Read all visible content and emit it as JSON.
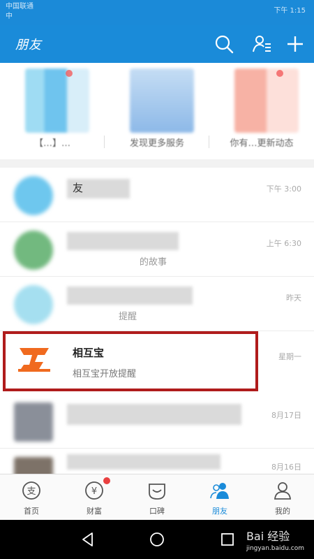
{
  "status_bar": {
    "carrier": "中国联通",
    "carrier2": "中",
    "time": "下午 1:15"
  },
  "header": {
    "title": "朋友",
    "icons": [
      "search-icon",
      "contacts-icon",
      "add-icon"
    ]
  },
  "services": [
    {
      "label": "【…】…",
      "has_dot": true
    },
    {
      "label": "发现更多服务",
      "has_dot": false
    },
    {
      "label": "你有…更新动态",
      "has_dot": true
    }
  ],
  "list": {
    "rows": [
      {
        "name": "友",
        "sub": "",
        "time": "下午 3:00"
      },
      {
        "name": "",
        "sub": "的故事",
        "time": "上午 6:30"
      },
      {
        "name": "",
        "sub": "提醒",
        "time": "昨天"
      },
      {
        "name": "",
        "sub": "",
        "time": "8月17日"
      },
      {
        "name": "",
        "sub": "",
        "time": "8月16日"
      }
    ],
    "highlighted": {
      "name": "相互宝",
      "sub": "相互宝开放提醒",
      "time": "星期一",
      "logo_icon": "xianghubao-logo-icon"
    }
  },
  "tabbar": {
    "tabs": [
      {
        "label": "首页",
        "icon": "alipay-home-icon"
      },
      {
        "label": "财富",
        "icon": "wealth-icon",
        "has_badge": true
      },
      {
        "label": "口碑",
        "icon": "koubei-icon"
      },
      {
        "label": "朋友",
        "icon": "friends-icon",
        "active": true
      },
      {
        "label": "我的",
        "icon": "profile-icon"
      }
    ]
  },
  "navbar": {
    "buttons": [
      "back-icon",
      "home-icon",
      "recents-icon"
    ]
  },
  "watermark": {
    "text": "Bai 经验",
    "sub": "jingyan.baidu.com"
  },
  "colors": {
    "brand_blue": "#1a8bd9",
    "highlight_border": "#b01c1c",
    "badge_red": "#e94040"
  }
}
